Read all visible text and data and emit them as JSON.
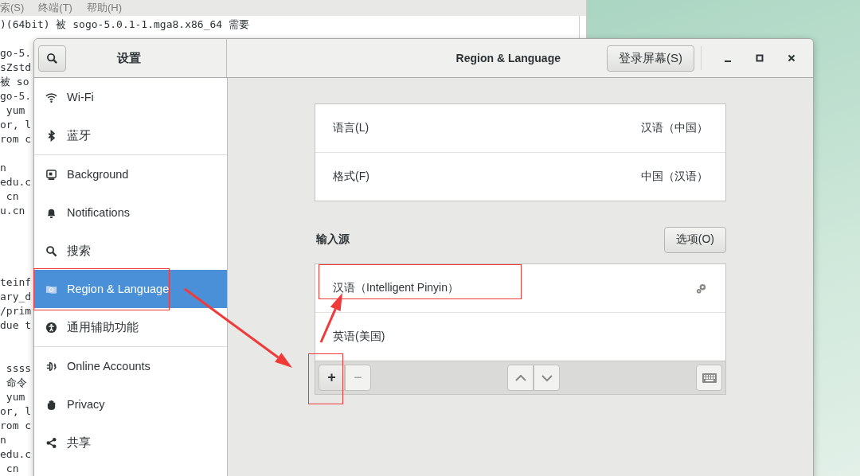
{
  "terminal": {
    "menu": [
      "索(S)",
      "终端(T)",
      "帮助(H)"
    ],
    "lines": [
      {
        "kind": "text",
        "text": ")(64bit) 被 sogo-5.0.1-1.mga8.x86_64 需要"
      },
      {
        "kind": "blank"
      },
      {
        "kind": "text",
        "text": "go-5."
      },
      {
        "kind": "text",
        "text": "sZstd"
      },
      {
        "kind": "text",
        "text": "被 so"
      },
      {
        "kind": "text",
        "text": "go-5."
      },
      {
        "kind": "text",
        "text": " yum"
      },
      {
        "kind": "text",
        "text": "or, l"
      },
      {
        "kind": "text",
        "text": "rom c"
      },
      {
        "kind": "blank"
      },
      {
        "kind": "text",
        "text": "n"
      },
      {
        "kind": "text",
        "text": "edu.c"
      },
      {
        "kind": "text",
        "text": " cn"
      },
      {
        "kind": "text",
        "text": "u.cn"
      },
      {
        "kind": "blank"
      },
      {
        "kind": "blank"
      },
      {
        "kind": "blank"
      },
      {
        "kind": "blank"
      },
      {
        "kind": "text",
        "text": "teinf"
      },
      {
        "kind": "text",
        "text": "ary_d"
      },
      {
        "kind": "text",
        "text": "/prim"
      },
      {
        "kind": "text",
        "text": "due t"
      },
      {
        "kind": "blank"
      },
      {
        "kind": "blank"
      },
      {
        "kind": "text",
        "text": " ssss"
      },
      {
        "kind": "text",
        "text": " 命令"
      },
      {
        "kind": "text",
        "text": " yum"
      },
      {
        "kind": "text",
        "text": "or, l"
      },
      {
        "kind": "text",
        "text": "rom c"
      },
      {
        "kind": "text",
        "text": "n"
      },
      {
        "kind": "text",
        "text": "edu.c"
      },
      {
        "kind": "text",
        "text": " cn"
      }
    ]
  },
  "window": {
    "sidebar_title": "设置",
    "title": "Region & Language",
    "header_button": "登录屏幕(S)"
  },
  "sidebar": {
    "groups": [
      [
        {
          "label": "Wi-Fi",
          "selected": false
        },
        {
          "label": "蓝牙",
          "selected": false
        }
      ],
      [
        {
          "label": "Background",
          "selected": false
        },
        {
          "label": "Notifications",
          "selected": false
        },
        {
          "label": "搜索",
          "selected": false
        },
        {
          "label": "Region & Language",
          "selected": true
        },
        {
          "label": "通用辅助功能",
          "selected": false
        }
      ],
      [
        {
          "label": "Online Accounts",
          "selected": false
        },
        {
          "label": "Privacy",
          "selected": false
        },
        {
          "label": "共享",
          "selected": false
        }
      ]
    ]
  },
  "settings": [
    {
      "label": "语言(L)",
      "value": "汉语（中国）"
    },
    {
      "label": "格式(F)",
      "value": "中国（汉语）"
    }
  ],
  "input_sources": {
    "heading": "输入源",
    "options_button": "选项(O)",
    "items": [
      {
        "label": "汉语（Intelligent Pinyin）",
        "has_settings": true
      },
      {
        "label": "英语(美国)",
        "has_settings": false
      }
    ],
    "toolbar": {
      "add": "+",
      "remove": "−"
    }
  },
  "annotation_marks": [
    {
      "kind": "box"
    },
    {
      "kind": "box"
    },
    {
      "kind": "box"
    },
    {
      "kind": "arrow"
    },
    {
      "kind": "arrow"
    }
  ]
}
